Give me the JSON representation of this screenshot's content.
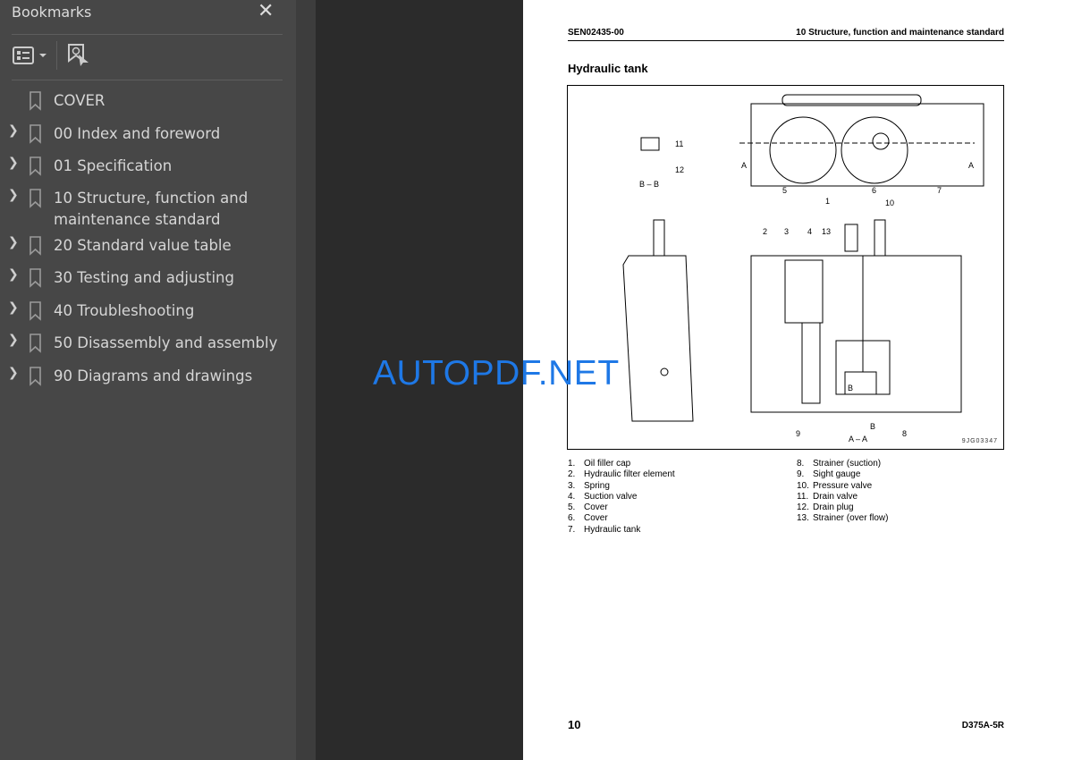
{
  "sidebar": {
    "title": "Bookmarks",
    "close_icon": "close-icon",
    "options_icon": "list-options-icon",
    "find_icon": "find-bookmark-icon",
    "items": [
      {
        "label": "COVER",
        "expandable": false
      },
      {
        "label": "00 Index and foreword",
        "expandable": true
      },
      {
        "label": "01 Specification",
        "expandable": true
      },
      {
        "label": "10 Structure, function and maintenance standard",
        "expandable": true
      },
      {
        "label": "20 Standard value table",
        "expandable": true
      },
      {
        "label": "30 Testing and adjusting",
        "expandable": true
      },
      {
        "label": "40 Troubleshooting",
        "expandable": true
      },
      {
        "label": "50 Disassembly and assembly",
        "expandable": true
      },
      {
        "label": "90 Diagrams and drawings",
        "expandable": true
      }
    ]
  },
  "page": {
    "header_left": "SEN02435-00",
    "header_right": "10 Structure, function and maintenance standard",
    "section_title": "Hydraulic tank",
    "figure_code": "9JG03347",
    "callouts": {
      "c1": "1",
      "c2": "2",
      "c3": "3",
      "c4": "4",
      "c5": "5",
      "c6": "6",
      "c7": "7",
      "c8": "8",
      "c9": "9",
      "c10": "10",
      "c11": "11",
      "c12": "12",
      "c13": "13",
      "secA1": "A",
      "secA2": "A",
      "secBB": "B – B",
      "secAA": "A – A",
      "secB1": "B",
      "secB2": "B"
    },
    "legend_left": [
      {
        "n": "1.",
        "t": "Oil filler cap"
      },
      {
        "n": "2.",
        "t": "Hydraulic filter element"
      },
      {
        "n": "3.",
        "t": "Spring"
      },
      {
        "n": "4.",
        "t": "Suction valve"
      },
      {
        "n": "5.",
        "t": "Cover"
      },
      {
        "n": "6.",
        "t": "Cover"
      },
      {
        "n": "7.",
        "t": "Hydraulic tank"
      }
    ],
    "legend_right": [
      {
        "n": "8.",
        "t": "Strainer (suction)"
      },
      {
        "n": "9.",
        "t": "Sight gauge"
      },
      {
        "n": "10.",
        "t": "Pressure valve"
      },
      {
        "n": "11.",
        "t": "Drain valve"
      },
      {
        "n": "12.",
        "t": "Drain plug"
      },
      {
        "n": "13.",
        "t": "Strainer (over flow)"
      }
    ],
    "footer_left": "10",
    "footer_right": "D375A-5R"
  },
  "watermark": "AUTOPDF.NET",
  "colors": {
    "sidebar_bg": "#474747",
    "viewer_bg": "#2b2b2b",
    "watermark": "#1e78e6"
  }
}
